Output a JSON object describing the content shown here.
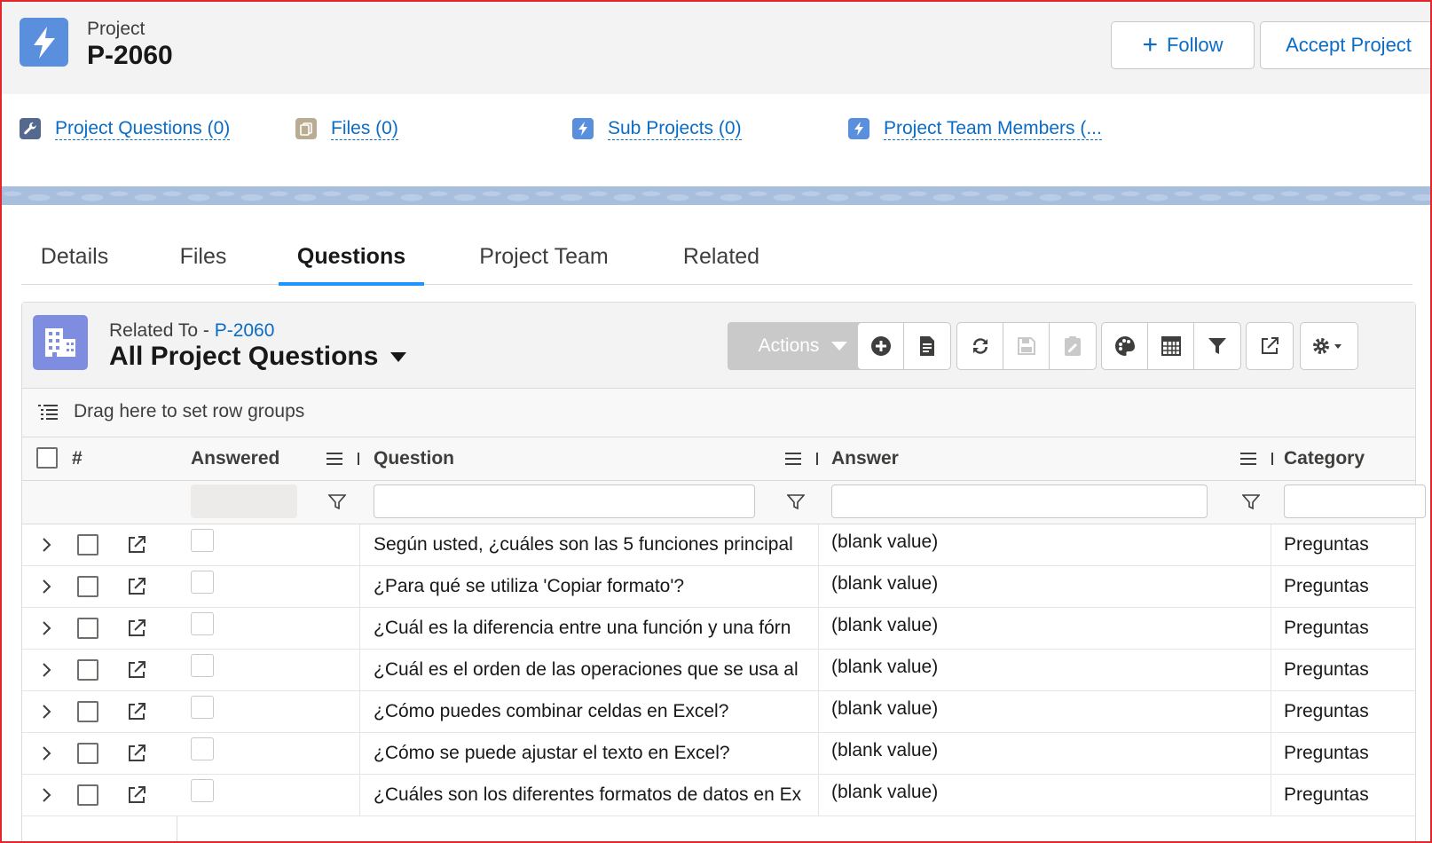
{
  "header": {
    "object_type": "Project",
    "record_name": "P-2060",
    "follow_label": "Follow",
    "accept_label": "Accept Project"
  },
  "related_links": [
    {
      "label": "Project Questions (0)",
      "icon": "wrench-icon",
      "color": "#54698d"
    },
    {
      "label": "Files (0)",
      "icon": "files-icon",
      "color": "#baac93"
    },
    {
      "label": "Sub Projects (0)",
      "icon": "lightning-icon",
      "color": "#5a8fde"
    },
    {
      "label": "Project Team Members (...",
      "icon": "lightning-icon",
      "color": "#5a8fde"
    }
  ],
  "tabs": [
    {
      "label": "Details",
      "active": false
    },
    {
      "label": "Files",
      "active": false
    },
    {
      "label": "Questions",
      "active": true
    },
    {
      "label": "Project Team",
      "active": false
    },
    {
      "label": "Related",
      "active": false
    }
  ],
  "list": {
    "related_to_prefix": "Related To - ",
    "related_to_link": "P-2060",
    "title": "All Project Questions",
    "actions_label": "Actions",
    "toolbar_icons": [
      "add-icon",
      "document-icon",
      "refresh-icon",
      "save-icon",
      "clipboard-edit-icon",
      "palette-icon",
      "table-icon",
      "filter-icon",
      "popout-icon",
      "gear-icon"
    ]
  },
  "grid": {
    "group_hint": "Drag here to set row groups",
    "columns": {
      "number": "#",
      "answered": "Answered",
      "question": "Question",
      "answer": "Answer",
      "category": "Category"
    },
    "rows": [
      {
        "question": "Según usted, ¿cuáles son las 5 funciones principal",
        "answer": "(blank value)",
        "category": "Preguntas"
      },
      {
        "question": "¿Para qué se utiliza 'Copiar formato'?",
        "answer": "(blank value)",
        "category": "Preguntas"
      },
      {
        "question": "¿Cuál es la diferencia entre una función y una fórn",
        "answer": "(blank value)",
        "category": "Preguntas"
      },
      {
        "question": "¿Cuál es el orden de las operaciones que se usa al",
        "answer": "(blank value)",
        "category": "Preguntas"
      },
      {
        "question": "¿Cómo puedes combinar celdas en Excel?",
        "answer": "(blank value)",
        "category": "Preguntas"
      },
      {
        "question": "¿Cómo se puede ajustar el texto en Excel?",
        "answer": "(blank value)",
        "category": "Preguntas"
      },
      {
        "question": "¿Cuáles son los diferentes formatos de datos en Ex",
        "answer": "(blank value)",
        "category": "Preguntas"
      }
    ]
  },
  "colors": {
    "link": "#0b6cc5",
    "tab_active": "#1b96ff",
    "frame_border": "#e3262c"
  }
}
